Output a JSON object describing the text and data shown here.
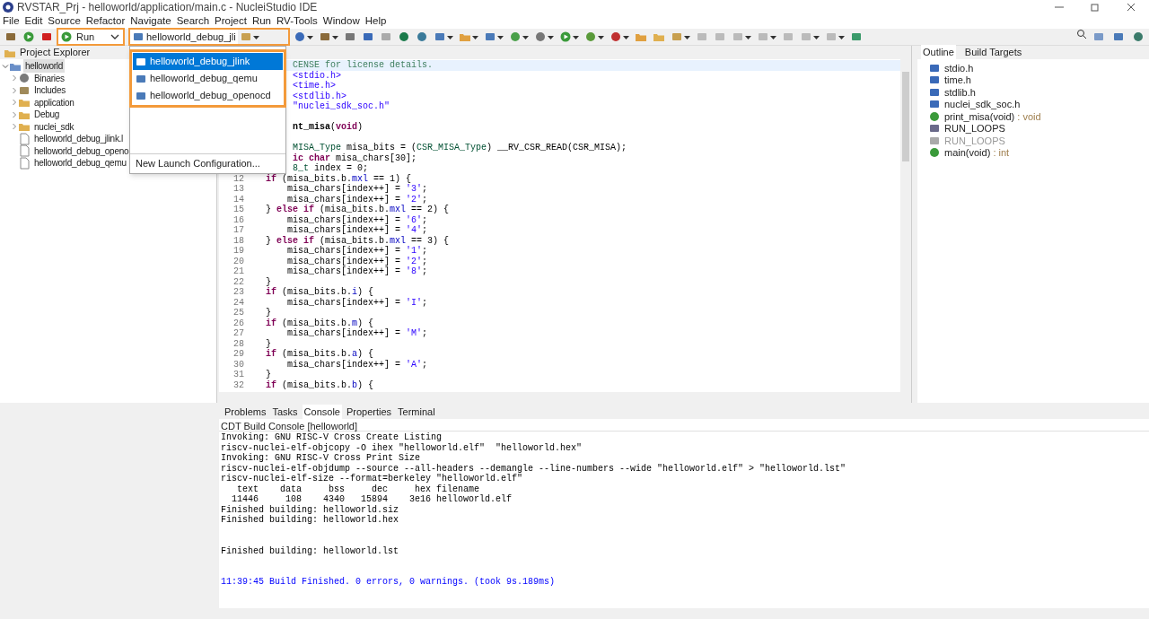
{
  "window": {
    "title": "RVSTAR_Prj - helloworld/application/main.c - NucleiStudio IDE"
  },
  "menu": [
    "File",
    "Edit",
    "Source",
    "Refactor",
    "Navigate",
    "Search",
    "Project",
    "Run",
    "RV-Tools",
    "Window",
    "Help"
  ],
  "toolbar": {
    "launch_mode": "Run",
    "launch_config": "helloworld_debug_jli"
  },
  "launch_menu": {
    "items": [
      {
        "label": "helloworld_debug_jlink",
        "selected": true
      },
      {
        "label": "helloworld_debug_qemu",
        "selected": false
      },
      {
        "label": "helloworld_debug_openocd",
        "selected": false
      }
    ],
    "footer": "New Launch Configuration..."
  },
  "project_explorer": {
    "title": "Project Explorer",
    "items": [
      {
        "label": "helloworld",
        "kind": "project",
        "expanded": true,
        "selected": true,
        "children": [
          {
            "label": "Binaries",
            "kind": "binaries",
            "expanded": false,
            "selected": false
          },
          {
            "label": "Includes",
            "kind": "includes",
            "expanded": false,
            "selected": false
          },
          {
            "label": "application",
            "kind": "folder",
            "expanded": false,
            "selected": false
          },
          {
            "label": "Debug",
            "kind": "folder",
            "expanded": false,
            "selected": false
          },
          {
            "label": "nuclei_sdk",
            "kind": "folder",
            "expanded": false,
            "selected": false
          },
          {
            "label": "helloworld_debug_jlink.l",
            "kind": "file",
            "selected": false
          },
          {
            "label": "helloworld_debug_openo",
            "kind": "file",
            "selected": false
          },
          {
            "label": "helloworld_debug_qemu",
            "kind": "file",
            "selected": false
          }
        ]
      }
    ]
  },
  "editor": {
    "lines": [
      {
        "kind": "code",
        "segs": [
          {
            "text": "CENSE for license details.",
            "kind": "comment"
          }
        ]
      },
      {
        "kind": "code",
        "segs": [
          {
            "text": "<stdio.h>",
            "kind": "string"
          }
        ]
      },
      {
        "kind": "code",
        "segs": [
          {
            "text": "<time.h>",
            "kind": "string"
          }
        ]
      },
      {
        "kind": "code",
        "segs": [
          {
            "text": "<stdlib.h>",
            "kind": "string"
          }
        ]
      },
      {
        "kind": "code",
        "segs": [
          {
            "text": "\"nuclei_sdk_soc.h\"",
            "kind": "string"
          }
        ]
      },
      {
        "kind": "blank"
      },
      {
        "kind": "code",
        "segs": [
          {
            "text": "nt_misa",
            "kind": "bold"
          },
          {
            "text": "(",
            "kind": "plain"
          },
          {
            "text": "void",
            "kind": "kw"
          },
          {
            "text": ")",
            "kind": "plain"
          }
        ]
      },
      {
        "kind": "blank"
      },
      {
        "kind": "code",
        "segs": [
          {
            "text": "MISA_Type",
            "kind": "type"
          },
          {
            "text": " misa_bits = (",
            "kind": "plain"
          },
          {
            "text": "CSR_MISA_Type",
            "kind": "type"
          },
          {
            "text": ") __RV_CSR_READ(CSR_MISA);",
            "kind": "plain"
          }
        ]
      },
      {
        "kind": "code",
        "segs": [
          {
            "text": "ic char",
            "kind": "kw"
          },
          {
            "text": " misa_chars[30];",
            "kind": "plain"
          }
        ]
      },
      {
        "kind": "code",
        "segs": [
          {
            "text": "8_t",
            "kind": "type"
          },
          {
            "text": " index = 0;",
            "kind": "plain"
          }
        ]
      },
      {
        "kind": "code",
        "num": "12",
        "segs": [
          {
            "text": "    if",
            "kind": "kw"
          },
          {
            "text": " (misa_bits.b.",
            "kind": "plain"
          },
          {
            "text": "mxl",
            "kind": "field"
          },
          {
            "text": " == 1) {",
            "kind": "plain"
          }
        ]
      },
      {
        "kind": "code",
        "num": "13",
        "segs": [
          {
            "text": "        misa_chars[index++] = ",
            "kind": "plain"
          },
          {
            "text": "'3'",
            "kind": "string"
          },
          {
            "text": ";",
            "kind": "plain"
          }
        ]
      },
      {
        "kind": "code",
        "num": "14",
        "segs": [
          {
            "text": "        misa_chars[index++] = ",
            "kind": "plain"
          },
          {
            "text": "'2'",
            "kind": "string"
          },
          {
            "text": ";",
            "kind": "plain"
          }
        ]
      },
      {
        "kind": "code",
        "num": "15",
        "segs": [
          {
            "text": "    } ",
            "kind": "plain"
          },
          {
            "text": "else if",
            "kind": "kw"
          },
          {
            "text": " (misa_bits.b.",
            "kind": "plain"
          },
          {
            "text": "mxl",
            "kind": "field"
          },
          {
            "text": " == 2) {",
            "kind": "plain"
          }
        ]
      },
      {
        "kind": "code",
        "num": "16",
        "segs": [
          {
            "text": "        misa_chars[index++] = ",
            "kind": "plain"
          },
          {
            "text": "'6'",
            "kind": "string"
          },
          {
            "text": ";",
            "kind": "plain"
          }
        ]
      },
      {
        "kind": "code",
        "num": "17",
        "segs": [
          {
            "text": "        misa_chars[index++] = ",
            "kind": "plain"
          },
          {
            "text": "'4'",
            "kind": "string"
          },
          {
            "text": ";",
            "kind": "plain"
          }
        ]
      },
      {
        "kind": "code",
        "num": "18",
        "segs": [
          {
            "text": "    } ",
            "kind": "plain"
          },
          {
            "text": "else if",
            "kind": "kw"
          },
          {
            "text": " (misa_bits.b.",
            "kind": "plain"
          },
          {
            "text": "mxl",
            "kind": "field"
          },
          {
            "text": " == 3) {",
            "kind": "plain"
          }
        ]
      },
      {
        "kind": "code",
        "num": "19",
        "segs": [
          {
            "text": "        misa_chars[index++] = ",
            "kind": "plain"
          },
          {
            "text": "'1'",
            "kind": "string"
          },
          {
            "text": ";",
            "kind": "plain"
          }
        ]
      },
      {
        "kind": "code",
        "num": "20",
        "segs": [
          {
            "text": "        misa_chars[index++] = ",
            "kind": "plain"
          },
          {
            "text": "'2'",
            "kind": "string"
          },
          {
            "text": ";",
            "kind": "plain"
          }
        ]
      },
      {
        "kind": "code",
        "num": "21",
        "segs": [
          {
            "text": "        misa_chars[index++] = ",
            "kind": "plain"
          },
          {
            "text": "'8'",
            "kind": "string"
          },
          {
            "text": ";",
            "kind": "plain"
          }
        ]
      },
      {
        "kind": "code",
        "num": "22",
        "segs": [
          {
            "text": "    }",
            "kind": "plain"
          }
        ]
      },
      {
        "kind": "code",
        "num": "23",
        "segs": [
          {
            "text": "    if",
            "kind": "kw"
          },
          {
            "text": " (misa_bits.b.",
            "kind": "plain"
          },
          {
            "text": "i",
            "kind": "field"
          },
          {
            "text": ") {",
            "kind": "plain"
          }
        ]
      },
      {
        "kind": "code",
        "num": "24",
        "segs": [
          {
            "text": "        misa_chars[index++] = ",
            "kind": "plain"
          },
          {
            "text": "'I'",
            "kind": "string"
          },
          {
            "text": ";",
            "kind": "plain"
          }
        ]
      },
      {
        "kind": "code",
        "num": "25",
        "segs": [
          {
            "text": "    }",
            "kind": "plain"
          }
        ]
      },
      {
        "kind": "code",
        "num": "26",
        "segs": [
          {
            "text": "    if",
            "kind": "kw"
          },
          {
            "text": " (misa_bits.b.",
            "kind": "plain"
          },
          {
            "text": "m",
            "kind": "field"
          },
          {
            "text": ") {",
            "kind": "plain"
          }
        ]
      },
      {
        "kind": "code",
        "num": "27",
        "segs": [
          {
            "text": "        misa_chars[index++] = ",
            "kind": "plain"
          },
          {
            "text": "'M'",
            "kind": "string"
          },
          {
            "text": ";",
            "kind": "plain"
          }
        ]
      },
      {
        "kind": "code",
        "num": "28",
        "segs": [
          {
            "text": "    }",
            "kind": "plain"
          }
        ]
      },
      {
        "kind": "code",
        "num": "29",
        "segs": [
          {
            "text": "    if",
            "kind": "kw"
          },
          {
            "text": " (misa_bits.b.",
            "kind": "plain"
          },
          {
            "text": "a",
            "kind": "field"
          },
          {
            "text": ") {",
            "kind": "plain"
          }
        ]
      },
      {
        "kind": "code",
        "num": "30",
        "segs": [
          {
            "text": "        misa_chars[index++] = ",
            "kind": "plain"
          },
          {
            "text": "'A'",
            "kind": "string"
          },
          {
            "text": ";",
            "kind": "plain"
          }
        ]
      },
      {
        "kind": "code",
        "num": "31",
        "segs": [
          {
            "text": "    }",
            "kind": "plain"
          }
        ]
      },
      {
        "kind": "code",
        "num": "32",
        "segs": [
          {
            "text": "    if",
            "kind": "kw"
          },
          {
            "text": " (misa_bits.b.",
            "kind": "plain"
          },
          {
            "text": "b",
            "kind": "field"
          },
          {
            "text": ") {",
            "kind": "plain"
          }
        ]
      }
    ]
  },
  "outline": {
    "tabs": [
      {
        "label": "Outline",
        "selected": true
      },
      {
        "label": "Build Targets",
        "selected": false
      }
    ],
    "items": [
      {
        "label": "stdio.h",
        "kind": "include"
      },
      {
        "label": "time.h",
        "kind": "include"
      },
      {
        "label": "stdlib.h",
        "kind": "include"
      },
      {
        "label": "nuclei_sdk_soc.h",
        "kind": "include"
      },
      {
        "label": "print_misa(void)",
        "detail": " : void",
        "kind": "function"
      },
      {
        "label": "RUN_LOOPS",
        "kind": "macro"
      },
      {
        "label": "RUN_LOOPS",
        "kind": "inactive_macro"
      },
      {
        "label": "main(void)",
        "detail": " : int",
        "kind": "function"
      }
    ]
  },
  "bottom": {
    "tabs": [
      {
        "label": "Problems",
        "selected": false
      },
      {
        "label": "Tasks",
        "selected": false
      },
      {
        "label": "Console",
        "selected": true
      },
      {
        "label": "Properties",
        "selected": false
      },
      {
        "label": "Terminal",
        "selected": false
      }
    ],
    "console_title": "CDT Build Console [helloworld]",
    "lines": [
      {
        "text": "Invoking: GNU RISC-V Cross Create Listing",
        "kind": "normal"
      },
      {
        "text": "riscv-nuclei-elf-objcopy -O ihex \"helloworld.elf\"  \"helloworld.hex\"",
        "kind": "normal"
      },
      {
        "text": "Invoking: GNU RISC-V Cross Print Size",
        "kind": "normal"
      },
      {
        "text": "riscv-nuclei-elf-objdump --source --all-headers --demangle --line-numbers --wide \"helloworld.elf\" > \"helloworld.lst\"",
        "kind": "normal"
      },
      {
        "text": "riscv-nuclei-elf-size --format=berkeley \"helloworld.elf\"",
        "kind": "normal"
      },
      {
        "text": "   text\t   data\t    bss\t    dec\t    hex\tfilename",
        "kind": "normal"
      },
      {
        "text": "  11446\t    108\t   4340\t  15894\t   3e16\thelloworld.elf",
        "kind": "normal"
      },
      {
        "text": "Finished building: helloworld.siz",
        "kind": "normal"
      },
      {
        "text": "Finished building: helloworld.hex",
        "kind": "normal"
      },
      {
        "kind": "blank"
      },
      {
        "kind": "blank"
      },
      {
        "text": "Finished building: helloworld.lst",
        "kind": "normal"
      },
      {
        "kind": "blank"
      },
      {
        "kind": "blank"
      },
      {
        "text": "11:39:45 Build Finished. 0 errors, 0 warnings. (took 9s.189ms)",
        "kind": "info"
      }
    ]
  }
}
